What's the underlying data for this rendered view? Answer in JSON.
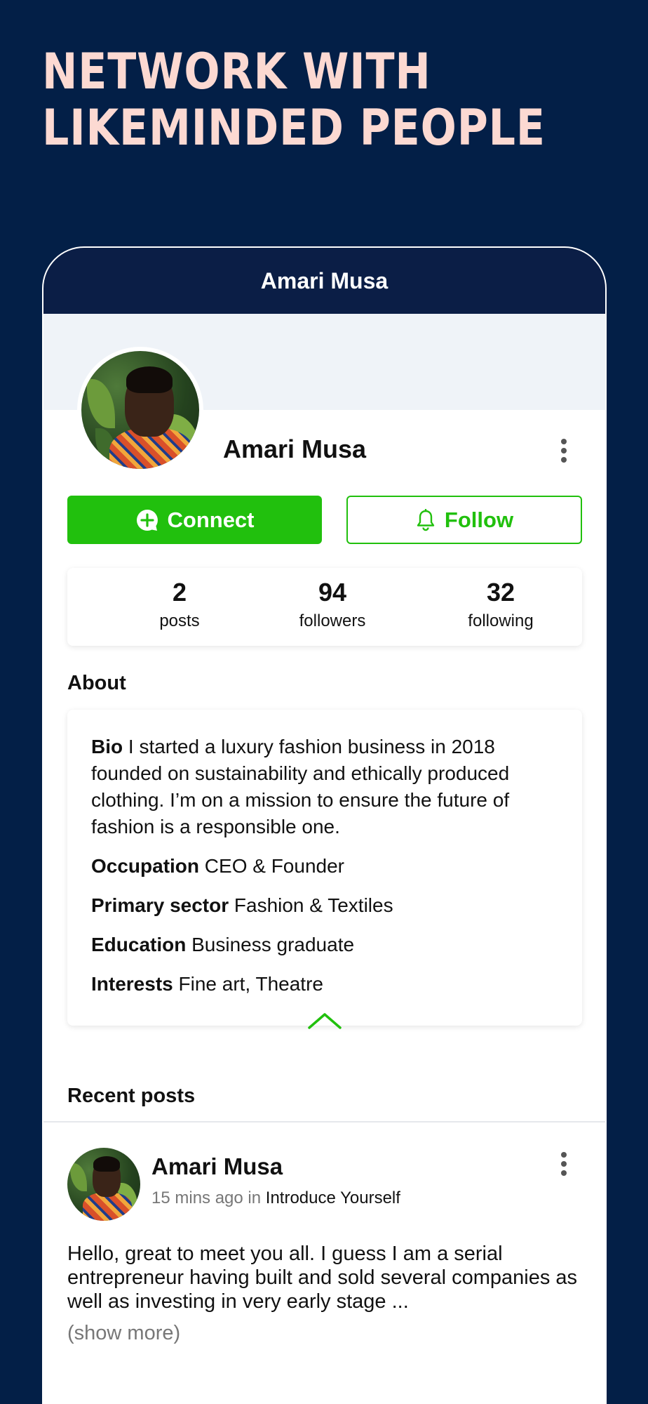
{
  "headline": {
    "line1": "NETWORK WITH",
    "line2": "LIKEMINDED PEOPLE"
  },
  "app_header": {
    "title": "Amari Musa"
  },
  "profile": {
    "name": "Amari Musa",
    "connect_label": "Connect",
    "follow_label": "Follow"
  },
  "stats": [
    {
      "value": "2",
      "label": "posts"
    },
    {
      "value": "94",
      "label": "followers"
    },
    {
      "value": "32",
      "label": "following"
    }
  ],
  "about": {
    "title": "About",
    "bio_label": "Bio",
    "bio_text": "I started a luxury fashion business in 2018 founded on sustainability and ethically produced clothing. I’m on a mission to ensure the future of fashion is a responsible one.",
    "occupation_label": "Occupation",
    "occupation_value": "CEO & Founder",
    "sector_label": "Primary sector",
    "sector_value": "Fashion & Textiles",
    "education_label": "Education",
    "education_value": "Business graduate",
    "interests_label": "Interests",
    "interests_value": "Fine art, Theatre"
  },
  "recent_posts": {
    "title": "Recent posts",
    "post": {
      "author": "Amari Musa",
      "time": "15 mins ago",
      "in_word": "in",
      "group": "Introduce Yourself",
      "body": "Hello, great to meet you all. I guess I am a serial entrepreneur having built and sold several companies as well as investing in very early stage ...",
      "show_more": "(show more)"
    }
  },
  "colors": {
    "background": "#031f47",
    "headline": "#fcd9d2",
    "header": "#0b1e46",
    "accent_green": "#21c00d"
  },
  "icons": {
    "connect": "chat-plus-icon",
    "follow": "bell-icon",
    "more": "kebab-menu-icon",
    "collapse": "chevron-up-icon"
  }
}
